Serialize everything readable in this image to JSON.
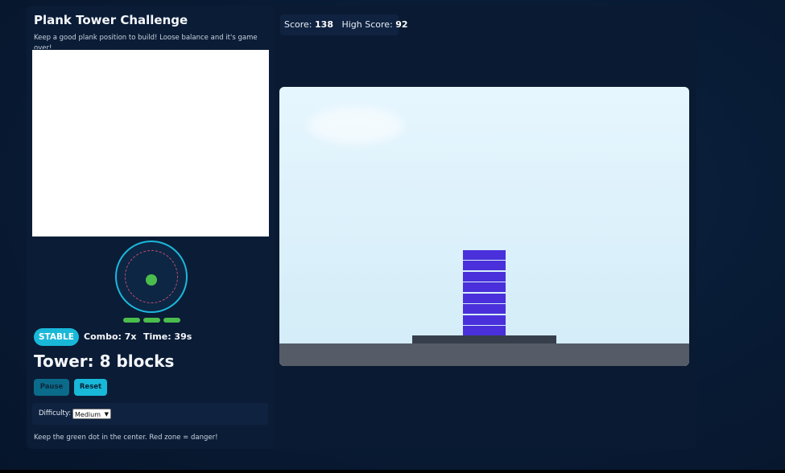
{
  "sidebar": {
    "title": "Plank Tower Challenge",
    "subtitle": "Keep a good plank position to build! Loose balance and it's game over!",
    "status_badge": "STABLE",
    "combo_text": "Combo: 7x",
    "time_text": "Time: 39s",
    "tower_text": "Tower: 8 blocks",
    "pause_label": "Pause",
    "reset_label": "Reset",
    "difficulty_label": "Difficulty:",
    "difficulty_value": "Medium",
    "hint": "Keep the green dot in the center. Red zone = danger!"
  },
  "scoreboard": {
    "score_label": "Score:",
    "score_value": "138",
    "high_score_label": "High Score:",
    "high_score_value": "92"
  },
  "game": {
    "tower_block_count": 8,
    "block_color": "#4a30da",
    "ground_color": "#555c67"
  },
  "colors": {
    "accent": "#19b8d9",
    "stable": "#4bbd4d",
    "danger": "#c0506e"
  },
  "icons": {
    "balance_indicator": "balance-dot",
    "difficulty_dropdown": "chevron-down-icon"
  }
}
